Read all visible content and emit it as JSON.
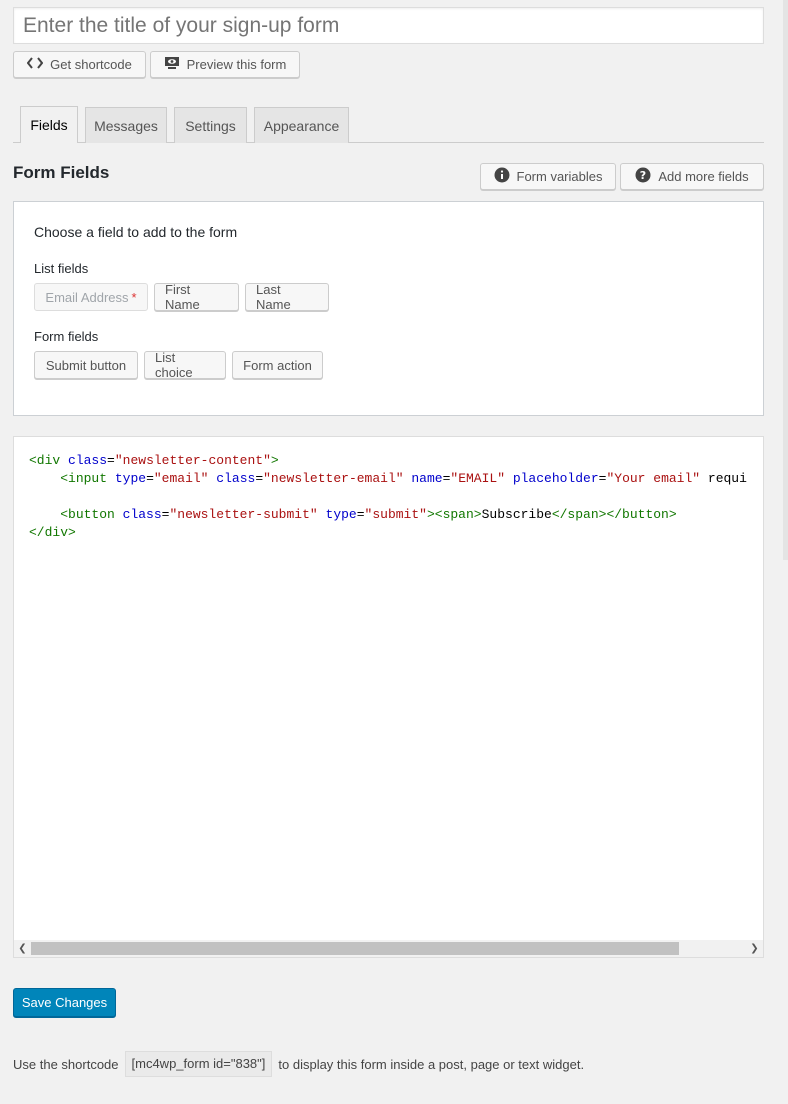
{
  "form": {
    "title_placeholder": "Enter the title of your sign-up form",
    "get_shortcode_label": "Get shortcode",
    "preview_label": "Preview this form"
  },
  "tabs": [
    {
      "label": "Fields",
      "active": true
    },
    {
      "label": "Messages",
      "active": false
    },
    {
      "label": "Settings",
      "active": false
    },
    {
      "label": "Appearance",
      "active": false
    }
  ],
  "fields_section": {
    "title": "Form Fields",
    "form_variables_label": "Form variables",
    "add_more_fields_label": "Add more fields",
    "choose_heading": "Choose a field to add to the form",
    "list_fields_label": "List fields",
    "list_fields": [
      {
        "label": "Email Address",
        "required_mark": "*",
        "disabled": true
      },
      {
        "label": "First Name"
      },
      {
        "label": "Last Name"
      }
    ],
    "form_fields_label": "Form fields",
    "form_fields": [
      {
        "label": "Submit button"
      },
      {
        "label": "List choice"
      },
      {
        "label": "Form action"
      }
    ]
  },
  "editor": {
    "lines": [
      "<div class=\"newsletter-content\">",
      "    <input type=\"email\" class=\"newsletter-email\" name=\"EMAIL\" placeholder=\"Your email\" requi",
      "",
      "    <button class=\"newsletter-submit\" type=\"submit\"><span>Subscribe</span></button>",
      "</div>"
    ]
  },
  "actions": {
    "save_label": "Save Changes"
  },
  "shortcode": {
    "prefix": "Use the shortcode",
    "code": "[mc4wp_form id=\"838\"]",
    "suffix": "to display this form inside a post, page or text widget."
  },
  "icons": {
    "code": "code-icon",
    "preview": "screen-eye-icon",
    "info": "info-icon",
    "help": "question-icon"
  },
  "colors": {
    "primary": "#0085ba",
    "tag": "#117700",
    "attr": "#0000cc",
    "string": "#aa1111"
  }
}
